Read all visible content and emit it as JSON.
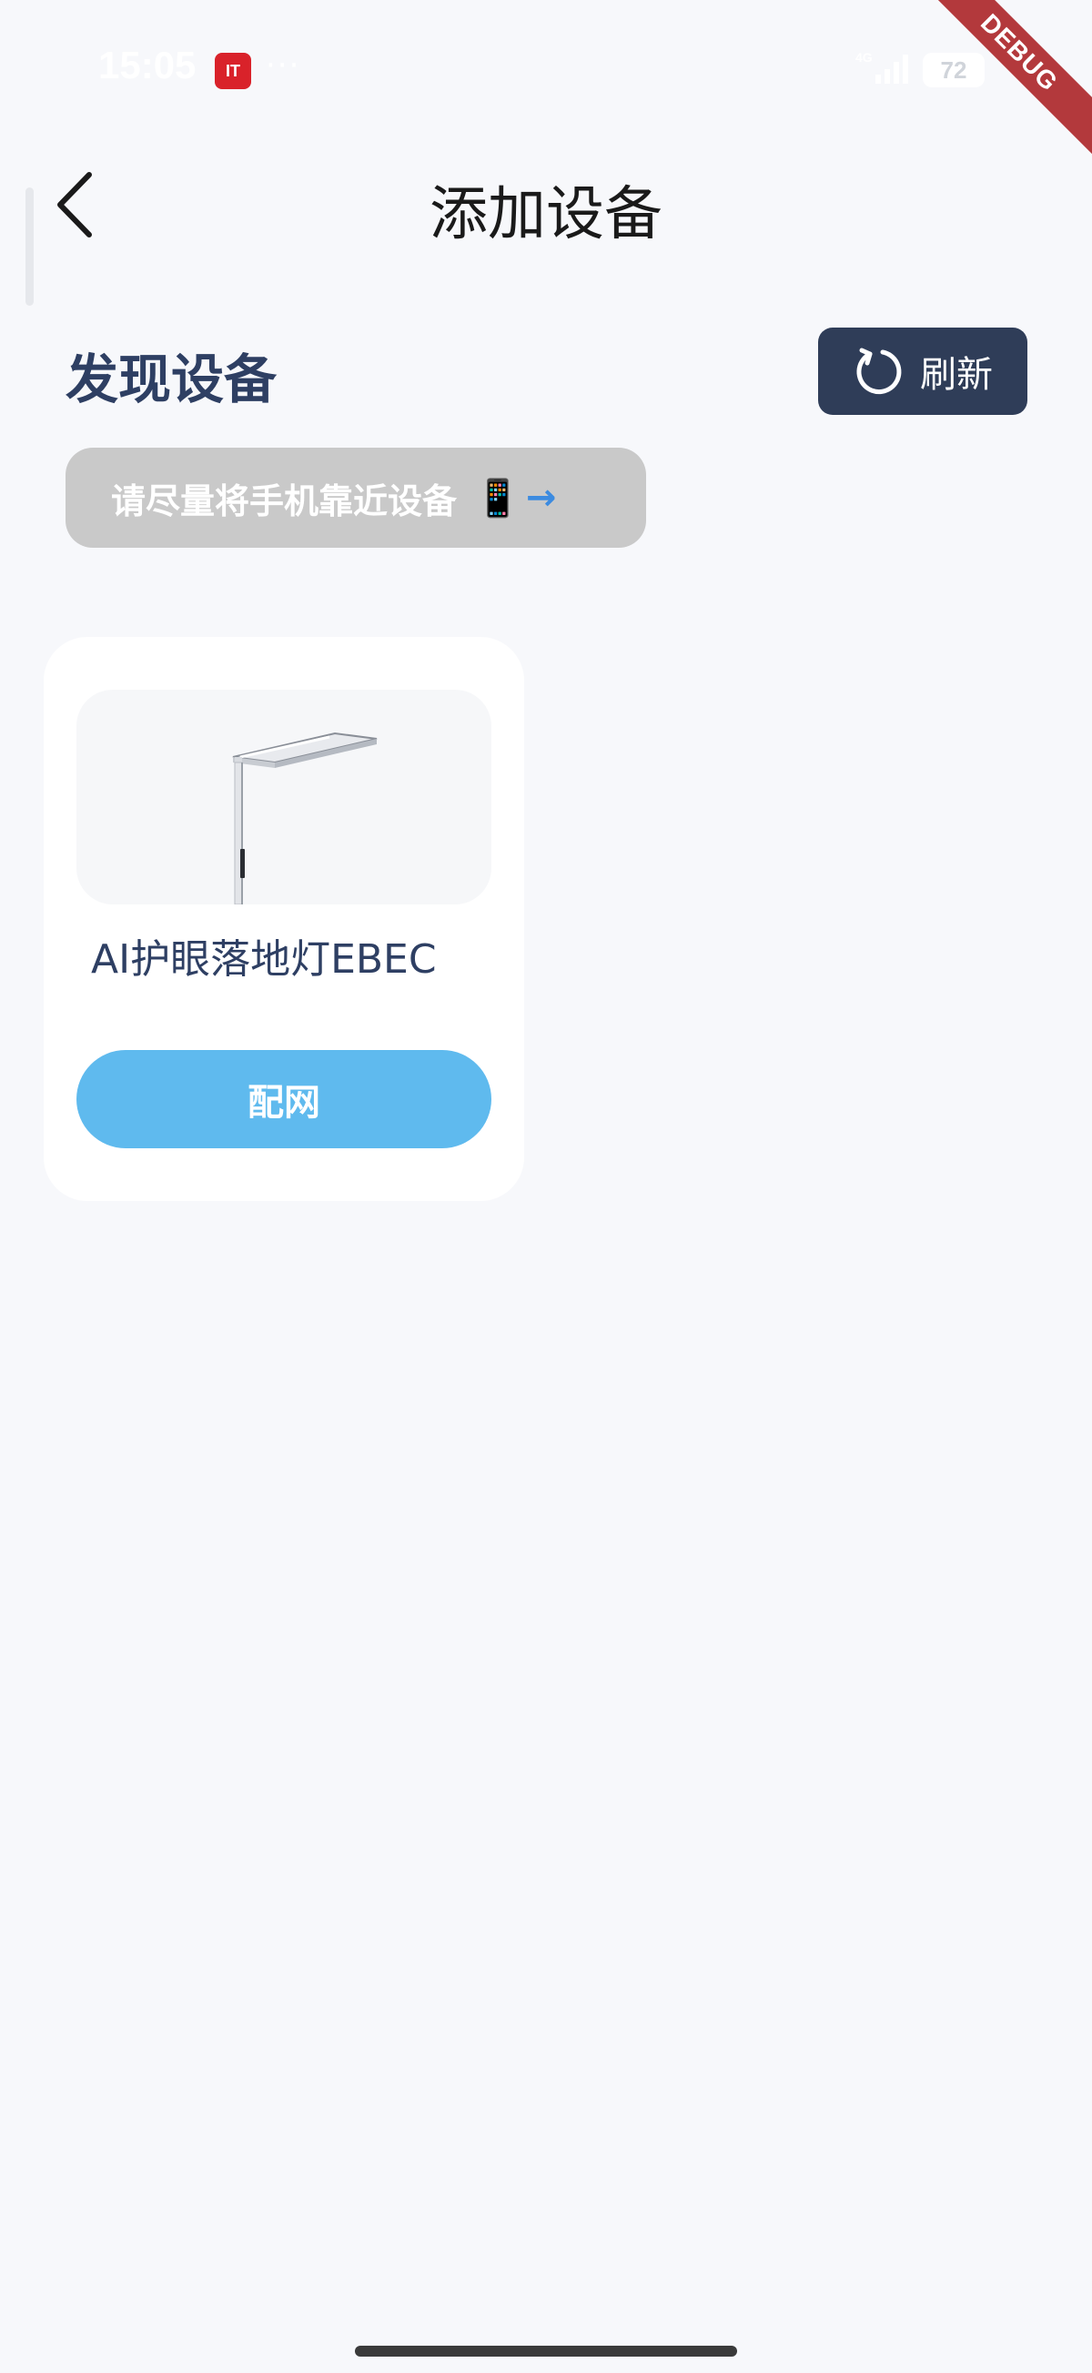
{
  "status_bar": {
    "time": "15:05",
    "app_icon_label": "IT",
    "dots": "···",
    "network_label": "4G",
    "battery": "72"
  },
  "debug_banner": "DEBUG",
  "header": {
    "title": "添加设备"
  },
  "discovery": {
    "section_title": "发现设备",
    "refresh_label": "刷新",
    "hint_text": "请尽量将手机靠近设备",
    "hint_emoji": "📱",
    "hint_arrow": "→"
  },
  "devices": [
    {
      "name": "AI护眼落地灯EBEC",
      "pair_label": "配网"
    }
  ],
  "colors": {
    "background": "#f7f8fb",
    "title_text": "#2e3f63",
    "refresh_button": "#2f3d58",
    "pair_button": "#5fbaee",
    "hint_pill": "#c9c9c9",
    "debug_ribbon": "#b3393c"
  }
}
